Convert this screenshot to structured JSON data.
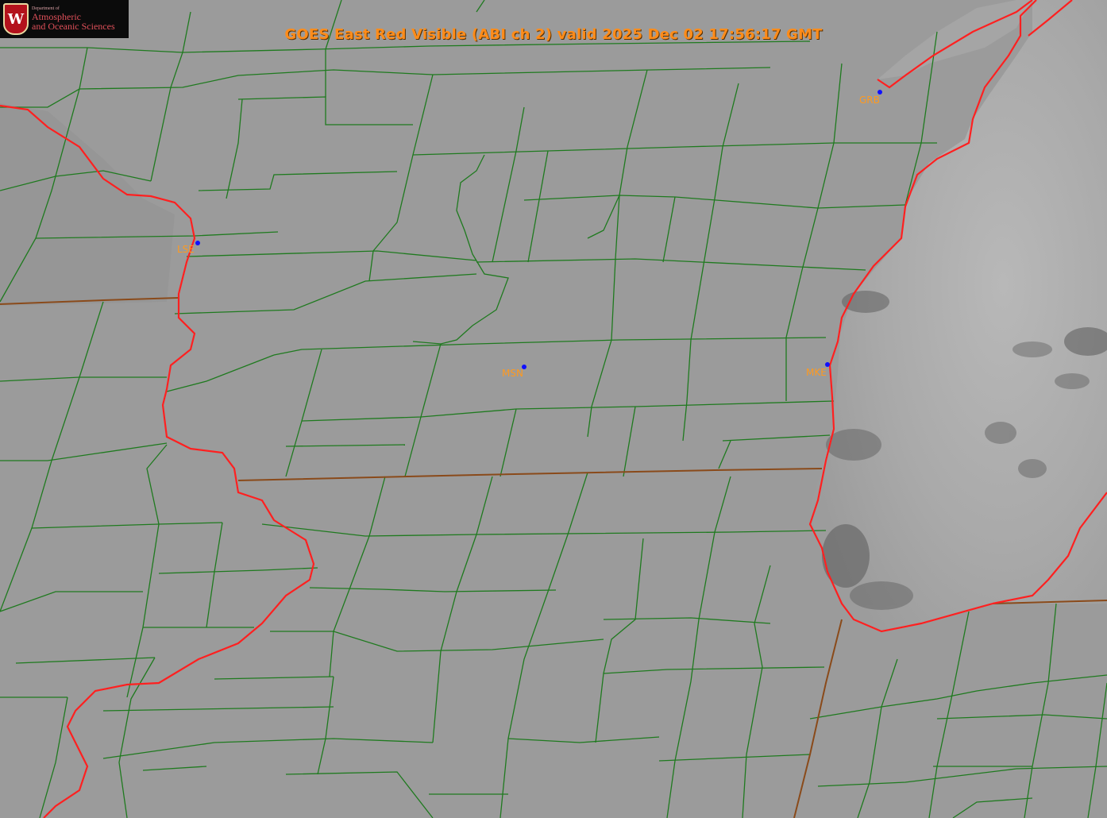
{
  "title": "GOES East Red Visible (ABI ch 2) valid 2025 Dec 02 17:56:17 GMT",
  "logo": {
    "dept_line": "Department of",
    "line1": "Atmospheric",
    "line2": "and Oceanic Sciences",
    "crest_letter": "W"
  },
  "stations": [
    {
      "id": "GRB",
      "label": "GRB"
    },
    {
      "id": "LSE",
      "label": "LSE"
    },
    {
      "id": "MSN",
      "label": "MSN"
    },
    {
      "id": "MKE",
      "label": "MKE"
    }
  ],
  "colors": {
    "county_lines": "#1f7a1f",
    "state_lines": "#8a4a1a",
    "coast_river": "#ff2020",
    "station_dot": "#1010ff",
    "station_label": "#ff9a1f",
    "land": "#9a9a9a",
    "lake": "#a8a8a8"
  }
}
